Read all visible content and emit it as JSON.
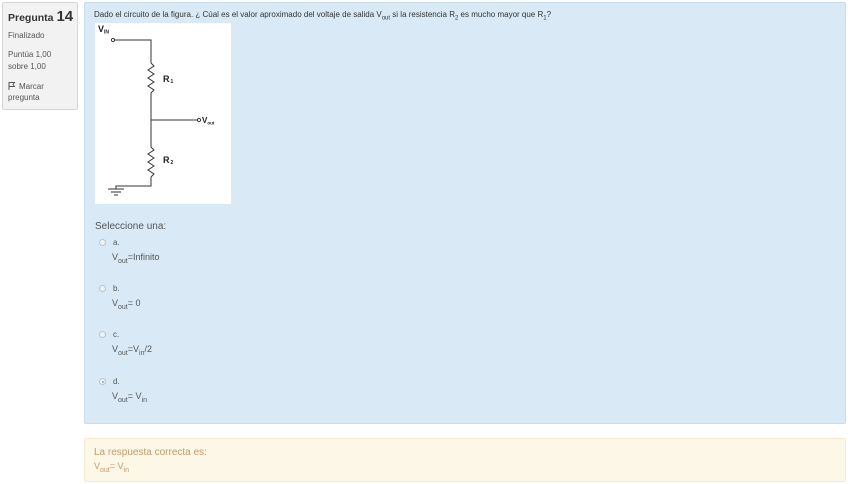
{
  "info": {
    "question_label": "Pregunta",
    "question_number": "14",
    "state": "Finalizado",
    "grade": "Puntúa 1,00 sobre 1,00",
    "flag_label": "Marcar pregunta"
  },
  "question": {
    "text_part1": "Dado el circuito de la figura. ¿ Cúal es el valor aproximado del voltaje de salida V",
    "text_sub1": "out",
    "text_part2": " si la resistencia R",
    "text_sub2": "2",
    "text_part3": " es mucho mayor que R",
    "text_sub3": "1",
    "text_part4": "?",
    "circuit": {
      "vin_main": "V",
      "vin_sub": "IN",
      "r1_main": "R",
      "r1_sub": "1",
      "r2_main": "R",
      "r2_sub": "2",
      "vout_main": "V",
      "vout_sub": "out"
    },
    "prompt": "Seleccione una:"
  },
  "options": [
    {
      "letter": "a.",
      "v": "V",
      "sub": "out",
      "rest": "=Infinito",
      "checked": false
    },
    {
      "letter": "b.",
      "v": "V",
      "sub": "out",
      "rest": "= 0",
      "checked": false
    },
    {
      "letter": "c.",
      "v": "V",
      "sub": "out",
      "rest": "=V",
      "sub2": "in",
      "rest2": "/2",
      "checked": false
    },
    {
      "letter": "d.",
      "v": "V",
      "sub": "out",
      "rest": "= V",
      "sub2": "in",
      "checked": true
    }
  ],
  "feedback": {
    "label": "La respuesta correcta es:",
    "v": "V",
    "sub": "out",
    "rest": "= V",
    "sub2": "in"
  },
  "colors": {
    "formulation_bg": "#d9eaf6",
    "feedback_bg": "#fcf7e6",
    "feedback_text": "#c39b6d",
    "info_bg": "#f2f2f2"
  }
}
